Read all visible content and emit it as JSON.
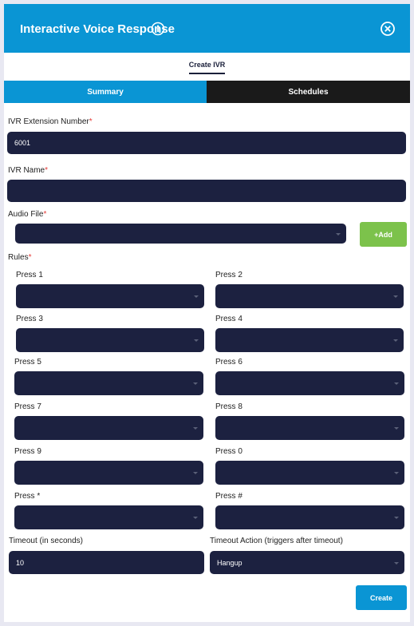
{
  "header": {
    "title": "Interactive Voice Response"
  },
  "subtab": {
    "label": "Create IVR"
  },
  "tabs": {
    "summary": "Summary",
    "schedules": "Schedules"
  },
  "extension": {
    "label": "IVR Extension Number",
    "value": "6001"
  },
  "ivr_name": {
    "label": "IVR Name",
    "value": ""
  },
  "audio": {
    "label": "Audio File",
    "value": "",
    "add_label": "+Add"
  },
  "rules": {
    "label": "Rules",
    "items": [
      {
        "label": "Press 1"
      },
      {
        "label": "Press 2"
      },
      {
        "label": "Press 3"
      },
      {
        "label": "Press 4"
      },
      {
        "label": "Press 5"
      },
      {
        "label": "Press 6"
      },
      {
        "label": "Press 7"
      },
      {
        "label": "Press 8"
      },
      {
        "label": "Press 9"
      },
      {
        "label": "Press 0"
      },
      {
        "label": "Press *"
      },
      {
        "label": "Press #"
      }
    ]
  },
  "timeout": {
    "label": "Timeout (in seconds)",
    "value": "10"
  },
  "timeout_action": {
    "label": "Timeout Action (triggers after timeout)",
    "value": "Hangup"
  },
  "actions": {
    "create_label": "Create"
  },
  "required_marker": "*",
  "colors": {
    "primary": "#0a95d4",
    "field_bg": "#1c2140",
    "add_button": "#7cc24b",
    "required": "#e53935"
  }
}
